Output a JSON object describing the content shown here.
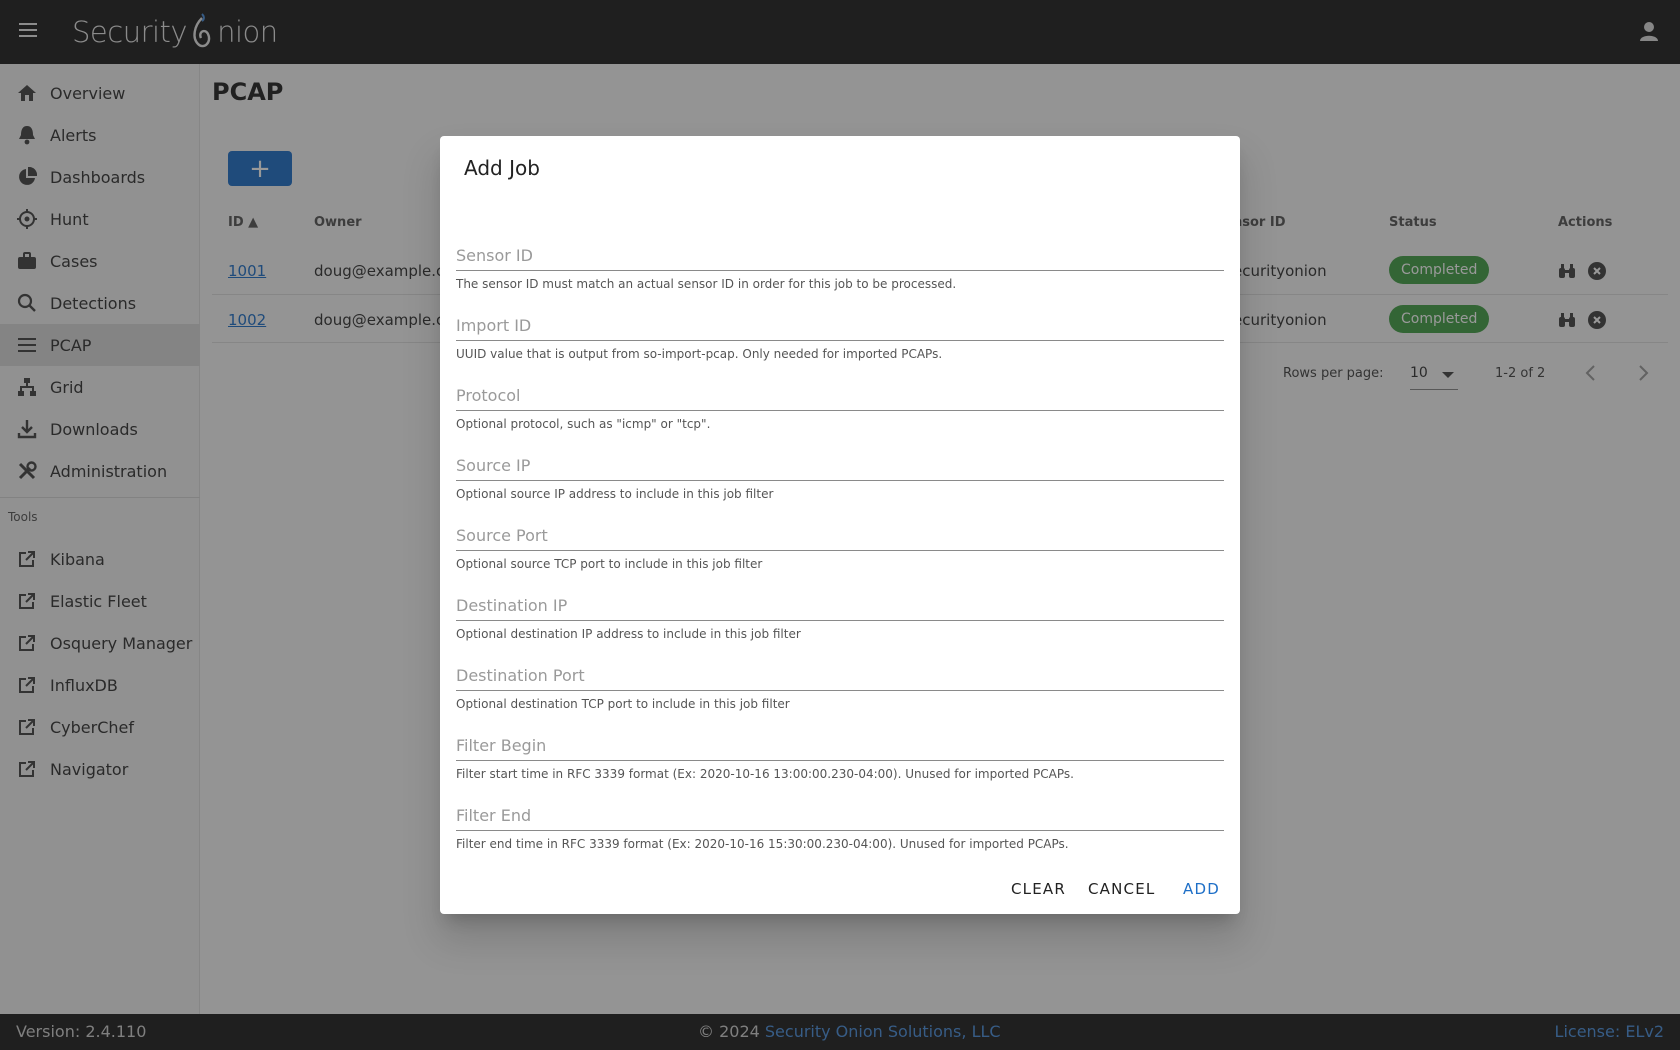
{
  "header": {
    "logo_text_left": "Security",
    "logo_text_right": "nion"
  },
  "sidebar": {
    "items": [
      {
        "label": "Overview",
        "icon": "home-icon"
      },
      {
        "label": "Alerts",
        "icon": "bell-icon"
      },
      {
        "label": "Dashboards",
        "icon": "pie-chart-icon"
      },
      {
        "label": "Hunt",
        "icon": "crosshairs-icon"
      },
      {
        "label": "Cases",
        "icon": "briefcase-icon"
      },
      {
        "label": "Detections",
        "icon": "search-icon"
      },
      {
        "label": "PCAP",
        "icon": "list-icon",
        "active": true
      },
      {
        "label": "Grid",
        "icon": "network-icon"
      },
      {
        "label": "Downloads",
        "icon": "download-icon"
      },
      {
        "label": "Administration",
        "icon": "tools-icon"
      }
    ],
    "tools_heading": "Tools",
    "tools": [
      {
        "label": "Kibana",
        "icon": "external-link-icon"
      },
      {
        "label": "Elastic Fleet",
        "icon": "external-link-icon"
      },
      {
        "label": "Osquery Manager",
        "icon": "external-link-icon"
      },
      {
        "label": "InfluxDB",
        "icon": "external-link-icon"
      },
      {
        "label": "CyberChef",
        "icon": "external-link-icon"
      },
      {
        "label": "Navigator",
        "icon": "external-link-icon"
      }
    ]
  },
  "main": {
    "title": "PCAP",
    "add_button": "+",
    "columns": {
      "id": "ID",
      "owner": "Owner",
      "sensor": "nsor ID",
      "status": "Status",
      "actions": "Actions"
    },
    "rows": [
      {
        "id": "1001",
        "owner": "doug@example.co",
        "sensor": "ecurityonion",
        "status": "Completed"
      },
      {
        "id": "1002",
        "owner": "doug@example.co",
        "sensor": "ecurityonion",
        "status": "Completed"
      }
    ],
    "pagination": {
      "rows_per_page_label": "Rows per page:",
      "rows_per_page": "10",
      "range": "1-2 of 2"
    }
  },
  "dialog": {
    "title": "Add Job",
    "fields": [
      {
        "placeholder": "Sensor ID",
        "hint": "The sensor ID must match an actual sensor ID in order for this job to be processed."
      },
      {
        "placeholder": "Import ID",
        "hint": "UUID value that is output from so-import-pcap. Only needed for imported PCAPs."
      },
      {
        "placeholder": "Protocol",
        "hint": "Optional protocol, such as \"icmp\" or \"tcp\"."
      },
      {
        "placeholder": "Source IP",
        "hint": "Optional source IP address to include in this job filter"
      },
      {
        "placeholder": "Source Port",
        "hint": "Optional source TCP port to include in this job filter"
      },
      {
        "placeholder": "Destination IP",
        "hint": "Optional destination IP address to include in this job filter"
      },
      {
        "placeholder": "Destination Port",
        "hint": "Optional destination TCP port to include in this job filter"
      },
      {
        "placeholder": "Filter Begin",
        "hint": "Filter start time in RFC 3339 format (Ex: 2020-10-16 13:00:00.230-04:00). Unused for imported PCAPs."
      },
      {
        "placeholder": "Filter End",
        "hint": "Filter end time in RFC 3339 format (Ex: 2020-10-16 15:30:00.230-04:00). Unused for imported PCAPs."
      }
    ],
    "buttons": {
      "clear": "CLEAR",
      "cancel": "CANCEL",
      "add": "ADD"
    }
  },
  "footer": {
    "version": "Version: 2.4.110",
    "copyright_prefix": "© 2024 ",
    "company": "Security Onion Solutions, LLC",
    "license": "License: ELv2"
  },
  "colors": {
    "accent": "#1e6fc7",
    "status_completed": "#43a047",
    "topbar": "#1e1e1e"
  }
}
